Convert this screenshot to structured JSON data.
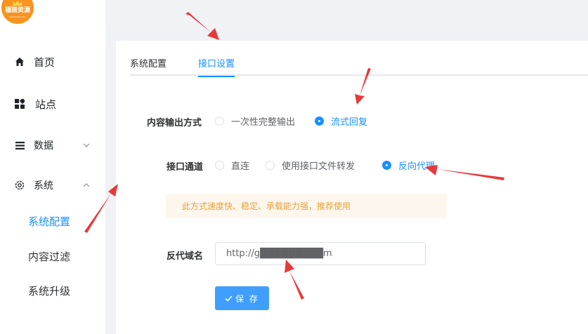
{
  "logo": {
    "name": "福丽资源",
    "sub": "www.fulizy.com"
  },
  "sidebar": {
    "items": [
      {
        "label": "首页",
        "icon": "home-icon"
      },
      {
        "label": "站点",
        "icon": "apps-icon"
      },
      {
        "label": "数据",
        "icon": "menu-icon"
      },
      {
        "label": "系统",
        "icon": "gear-icon"
      }
    ],
    "subitems": [
      {
        "label": "系统配置",
        "active": true
      },
      {
        "label": "内容过滤",
        "active": false
      },
      {
        "label": "系统升级",
        "active": false
      }
    ]
  },
  "tabs": [
    {
      "label": "系统配置",
      "active": false
    },
    {
      "label": "接口设置",
      "active": true
    }
  ],
  "form": {
    "output_label": "内容输出方式",
    "output_options": [
      {
        "label": "一次性完整输出",
        "checked": false
      },
      {
        "label": "流式回复",
        "checked": true
      }
    ],
    "channel_label": "接口通道",
    "channel_options": [
      {
        "label": "直连",
        "checked": false
      },
      {
        "label": "使用接口文件转发",
        "checked": false
      },
      {
        "label": "反向代理",
        "checked": true
      }
    ],
    "alert_text": "此方式速度快、稳定、承载能力强，推荐使用",
    "domain_label": "反代域名",
    "domain_value": "http://g█████████m",
    "save_label": "保 存"
  },
  "colors": {
    "accent": "#1890ff",
    "button": "#409eff",
    "alert_bg": "#fdf6ec",
    "alert_text": "#e6a23c",
    "arrow": "#e8393a",
    "logo": "#f7931e"
  }
}
